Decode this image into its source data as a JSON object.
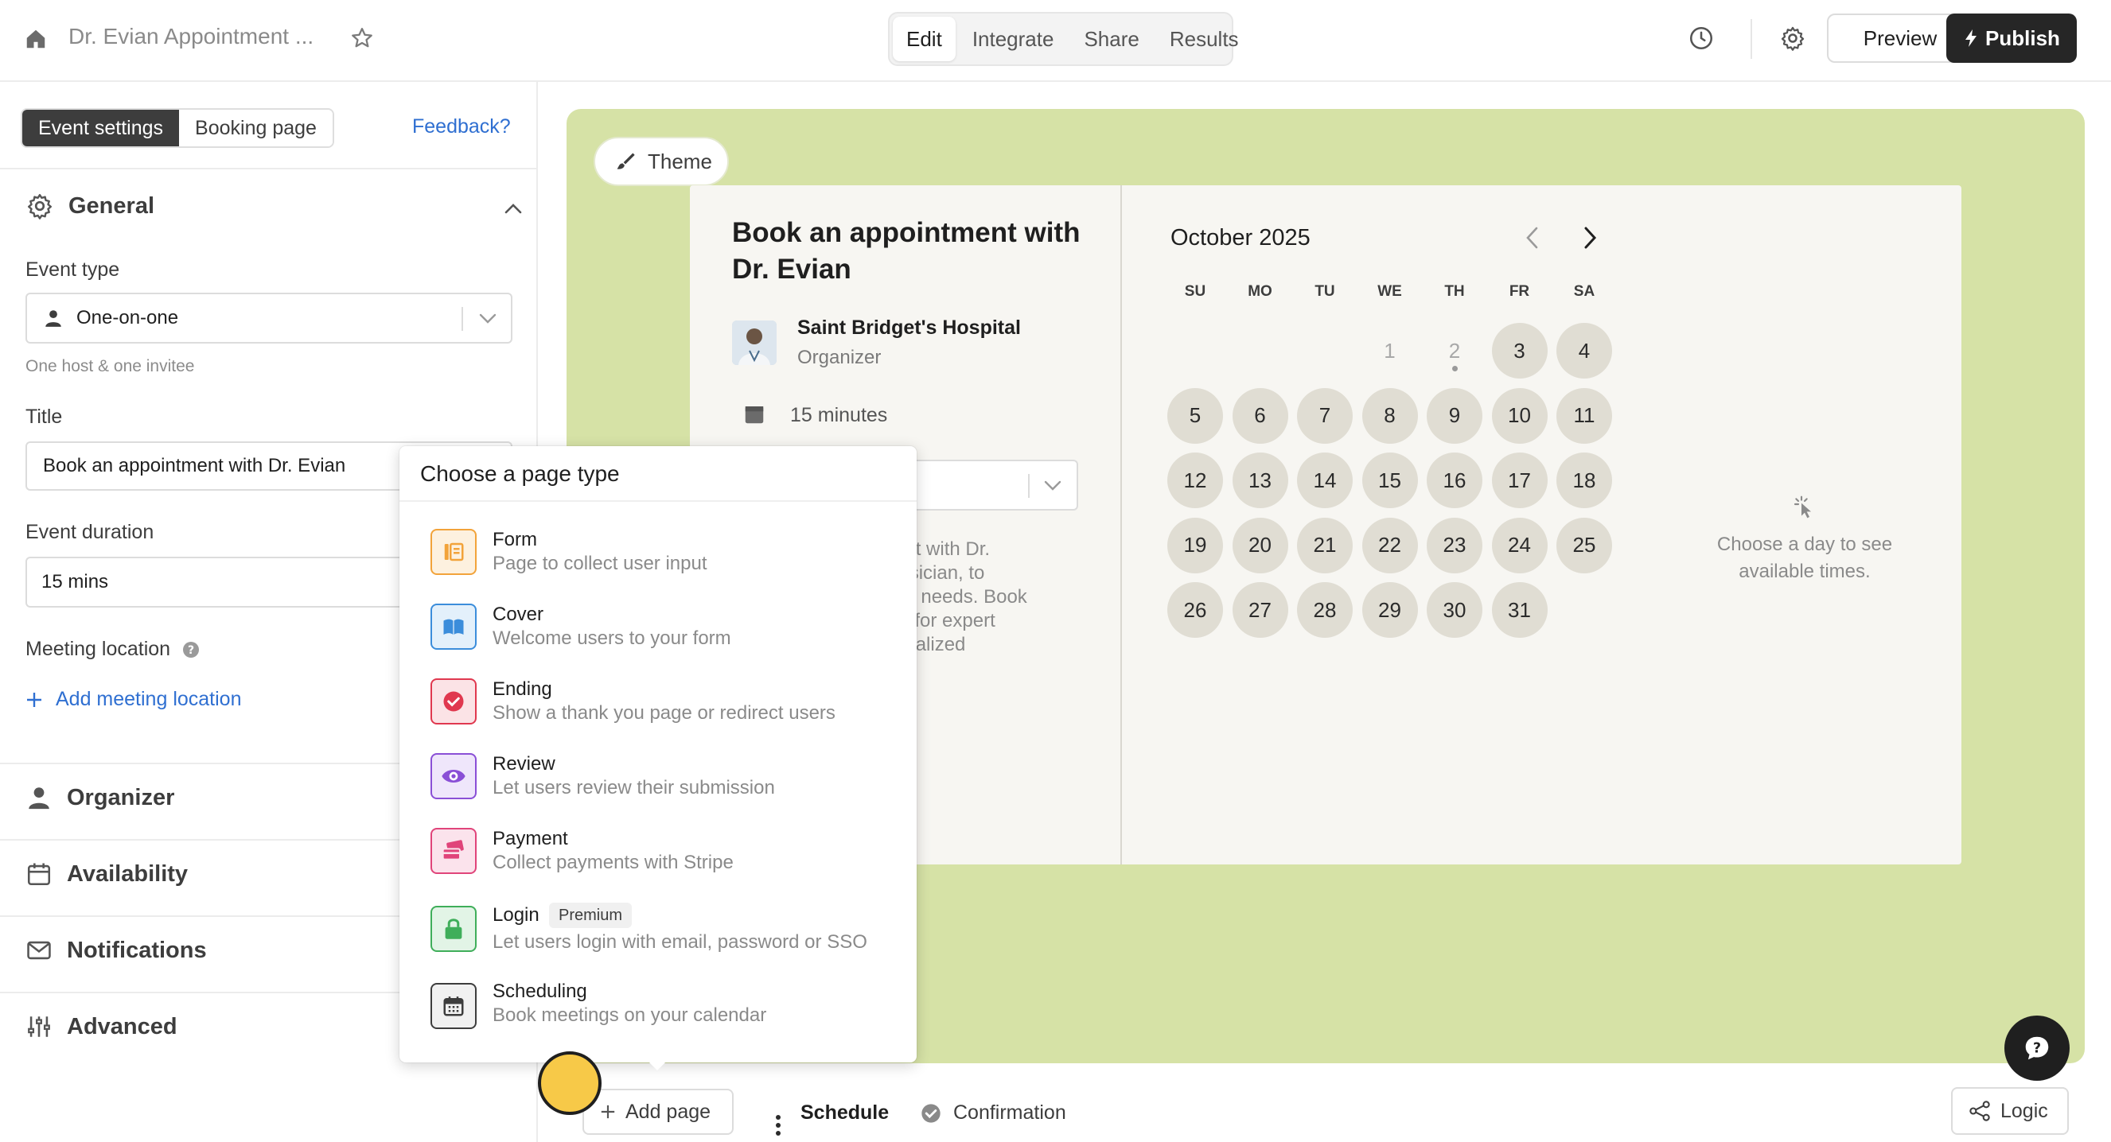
{
  "topbar": {
    "doc_title": "Dr. Evian Appointment ...",
    "tabs": [
      "Edit",
      "Integrate",
      "Share",
      "Results"
    ],
    "active_tab": "Edit",
    "preview_label": "Preview",
    "publish_label": "Publish"
  },
  "sidebar": {
    "segments": [
      "Event settings",
      "Booking page"
    ],
    "active_segment": "Event settings",
    "feedback_label": "Feedback?",
    "general": {
      "title": "General",
      "event_type_label": "Event type",
      "event_type_value": "One-on-one",
      "event_type_hint": "One host & one invitee",
      "title_label": "Title",
      "title_value": "Book an appointment with Dr. Evian",
      "duration_label": "Event duration",
      "duration_value": "15 mins",
      "location_label": "Meeting location",
      "add_location_label": "Add meeting location"
    },
    "sections": [
      "Organizer",
      "Availability",
      "Notifications",
      "Advanced"
    ]
  },
  "canvas": {
    "background": "#d6e2a6",
    "theme_label": "Theme",
    "booking": {
      "title": "Book an appointment with Dr. Evian",
      "organizer_name": "Saint Bridget's Hospital",
      "organizer_role": "Organizer",
      "duration": "15 minutes",
      "description_lines": [
        "ment with Dr.",
        "physician, to",
        "care needs. Book",
        "day for expert",
        "rsonalized"
      ]
    },
    "calendar": {
      "month": "October 2025",
      "weekdays": [
        "SU",
        "MO",
        "TU",
        "WE",
        "TH",
        "FR",
        "SA"
      ],
      "first_weekday_index": 3,
      "days_in_month": 31,
      "unavailable_days": [
        1,
        2
      ],
      "today": 2,
      "empty_state": "Choose a day to see available times."
    }
  },
  "page_type_menu": {
    "title": "Choose a page type",
    "items": [
      {
        "title": "Form",
        "desc": "Page to collect user input",
        "icon": "form-icon",
        "color": "#f2a33a"
      },
      {
        "title": "Cover",
        "desc": "Welcome users to your form",
        "icon": "book-icon",
        "color": "#3b8ddb"
      },
      {
        "title": "Ending",
        "desc": "Show a thank you page or redirect users",
        "icon": "check-circle-icon",
        "color": "#e0384f"
      },
      {
        "title": "Review",
        "desc": "Let users review their submission",
        "icon": "eye-icon",
        "color": "#8a4fd6"
      },
      {
        "title": "Payment",
        "desc": "Collect payments with Stripe",
        "icon": "card-icon",
        "color": "#e0447a"
      },
      {
        "title": "Login",
        "desc": "Let users login with email, password or SSO",
        "icon": "lock-icon",
        "color": "#3fae5a",
        "badge": "Premium"
      },
      {
        "title": "Scheduling",
        "desc": "Book meetings on your calendar",
        "icon": "calendar-icon",
        "color": "#3d3d3d"
      }
    ]
  },
  "bottombar": {
    "add_page_label": "Add page",
    "pages": [
      "Schedule",
      "Confirmation"
    ],
    "logic_label": "Logic"
  }
}
